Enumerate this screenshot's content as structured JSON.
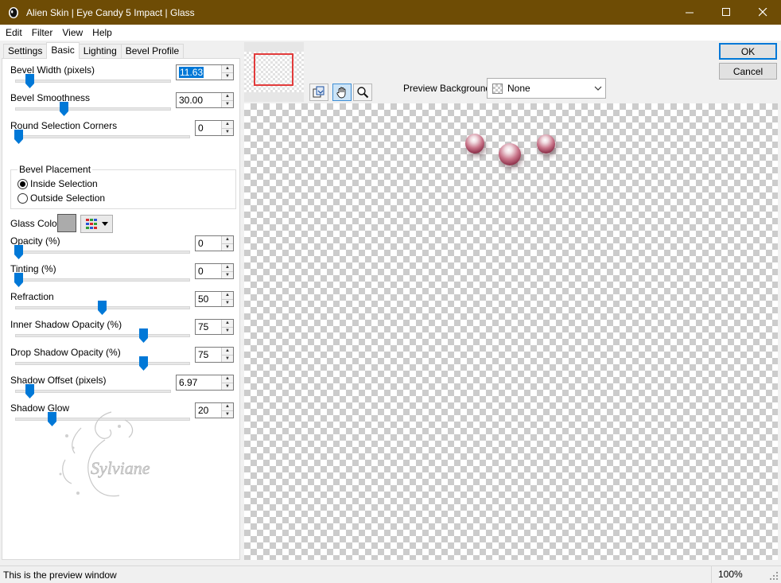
{
  "window": {
    "title": "Alien Skin | Eye Candy 5 Impact | Glass",
    "titlebar_color": "#6e4c05"
  },
  "menu": [
    {
      "label": "Edit"
    },
    {
      "label": "Filter"
    },
    {
      "label": "View"
    },
    {
      "label": "Help"
    }
  ],
  "tabs": [
    {
      "label": "Settings"
    },
    {
      "label": "Basic"
    },
    {
      "label": "Lighting"
    },
    {
      "label": "Bevel Profile"
    }
  ],
  "active_tab": "Basic",
  "params": {
    "bevel_width": {
      "label": "Bevel Width (pixels)",
      "value": "11.63"
    },
    "bevel_smoothness": {
      "label": "Bevel Smoothness",
      "value": "30.00"
    },
    "round_corners": {
      "label": "Round Selection Corners",
      "value": "0"
    },
    "opacity": {
      "label": "Opacity (%)",
      "value": "0"
    },
    "tinting": {
      "label": "Tinting (%)",
      "value": "0"
    },
    "refraction": {
      "label": "Refraction",
      "value": "50"
    },
    "inner_shadow": {
      "label": "Inner Shadow Opacity (%)",
      "value": "75"
    },
    "drop_shadow": {
      "label": "Drop Shadow Opacity (%)",
      "value": "75"
    },
    "shadow_offset": {
      "label": "Shadow Offset (pixels)",
      "value": "6.97"
    },
    "shadow_glow": {
      "label": "Shadow Glow",
      "value": "20"
    }
  },
  "bevel_placement": {
    "legend": "Bevel Placement",
    "inside": "Inside Selection",
    "outside": "Outside Selection",
    "selected": "inside"
  },
  "glass_color": {
    "label": "Glass Color",
    "value": "#ababab"
  },
  "preview_background": {
    "label": "Preview Background:",
    "value": "None"
  },
  "buttons": {
    "ok": "OK",
    "cancel": "Cancel"
  },
  "status": {
    "message": "This is the preview window",
    "zoom": "100%"
  },
  "accent_color": "#0078d7",
  "watermark_text": "Sylviane"
}
